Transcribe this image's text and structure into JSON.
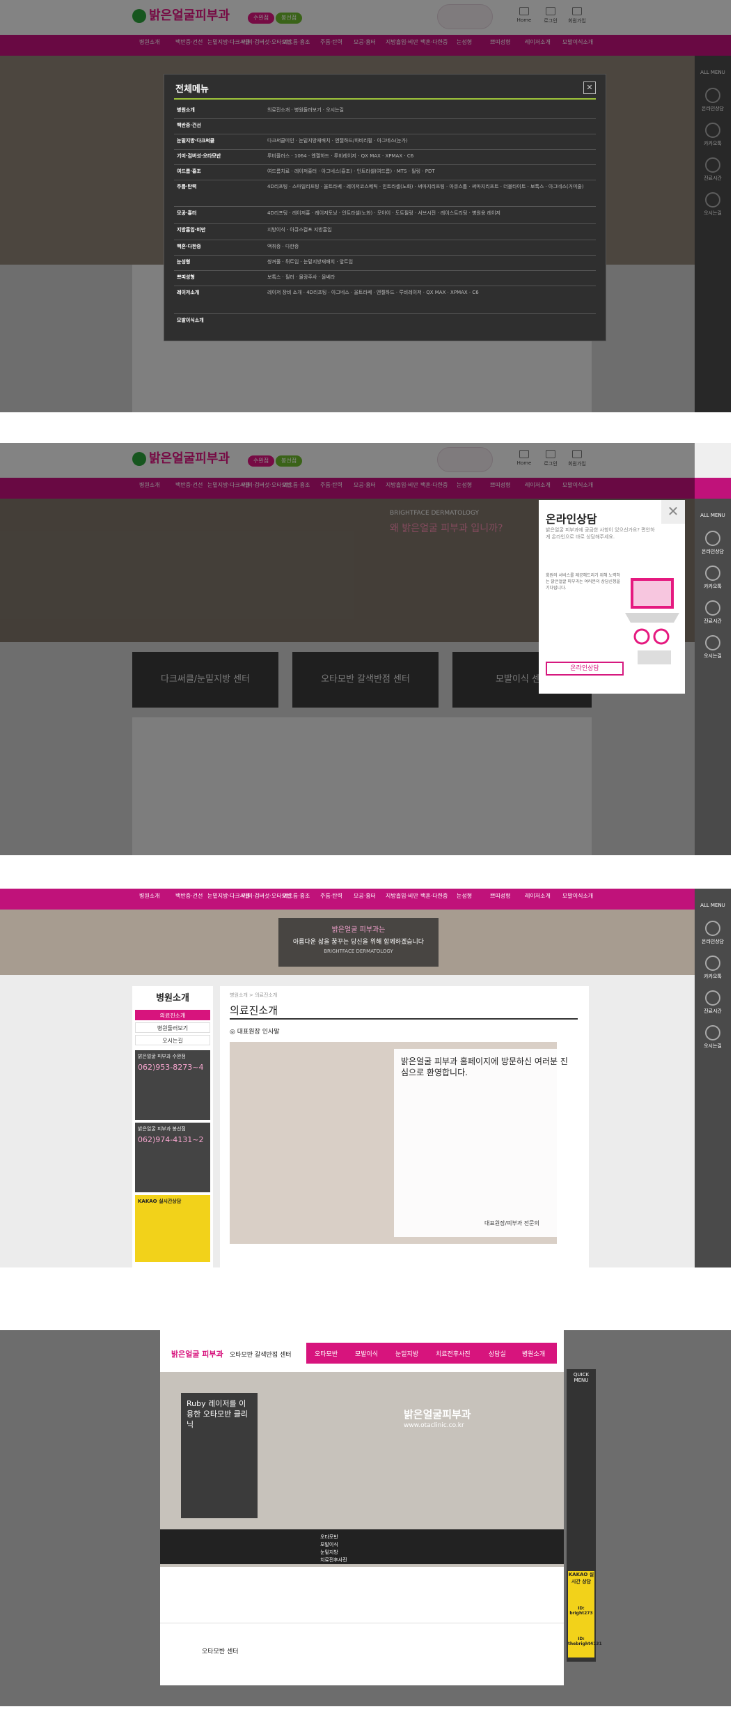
{
  "logo": {
    "name": "밝은얼굴피부과"
  },
  "branches": {
    "suwan": "수완점",
    "bongseon": "봉선점"
  },
  "utility": {
    "home": "Home",
    "login": "로그인",
    "join": "회원가입"
  },
  "nav": [
    "병원소개",
    "백반증·건선",
    "눈밑지방·다크써클",
    "기미·검버섯·오타모반",
    "여드름·흉조",
    "주름·탄력",
    "모공·흉터",
    "지방흡입·비만",
    "백혼·다한증",
    "눈성형",
    "쁘띠성형",
    "레이저소개",
    "모발이식소개"
  ],
  "side_menu": {
    "all": "ALL MENU",
    "items": [
      "온라인상담",
      "카카오톡",
      "진료시간",
      "오시는길"
    ]
  },
  "full_menu": {
    "title": "전체메뉴",
    "rows": [
      {
        "cat": "병원소개",
        "subs": "의료진소개 · 병원둘러보기 · 오시는길"
      },
      {
        "cat": "백반증·건선",
        "subs": ""
      },
      {
        "cat": "눈밑지방·다크써클",
        "subs": "다크써클미인 · 눈밑지방재배치 · 엔젤하드/하비리필 · 아그네스(눈가)"
      },
      {
        "cat": "기미·검버섯·오타모반",
        "subs": "루비플러스 · 1064 · 엔젤하드 · 루비레이저 · QX MAX · XPMAX · C6"
      },
      {
        "cat": "여드름·흉조",
        "subs": "여드름치료 · 레이저흉터 · 아그네스(흉조) · 인트라셀(여드름) · MTS · 필링 · PDT"
      },
      {
        "cat": "주름·탄력",
        "subs": "4D리프팅 · 스마일리프팅 · 울트라쎄 · 레이저코스메틱 · 인트라셀(노화) · 써마지리프팅 · 아큐스톰 · 써마지리프트 · 더블타이트 · 보톡스 · 아그네스(거미줄)"
      },
      {
        "cat": "모공·흉터",
        "subs": "4D리프팅 · 레이저흉 · 레이저토닝 · 인트라셀(노화) · 모아이 · 도트필링 · 서브시전 · 레이스트리팅 · 병원용 레이저"
      },
      {
        "cat": "지방흡입·비만",
        "subs": "지방이식 · 아큐스컬프 지방흡입"
      },
      {
        "cat": "백혼·다한증",
        "subs": "액취증 · 다한증"
      },
      {
        "cat": "눈성형",
        "subs": "쌍꺼풀 · 뒤트임 · 눈밑지방재배치 · 앞트임"
      },
      {
        "cat": "쁘띠성형",
        "subs": "보톡스 · 필러 · 물광주사 · 울쎄라"
      },
      {
        "cat": "레이저소개",
        "subs": "레이저 장비 소개 · 4D리프팅 · 아그네스 · 울트라쎄 · 엔젤하드 · 루비레이저 · QX MAX · XPMAX · C6"
      },
      {
        "cat": "모발이식소개",
        "subs": ""
      }
    ]
  },
  "consult": {
    "title": "온라인상담",
    "subtitle": "밝은얼굴 피부과에 궁금한 사항이 있으신가요? 편안하게 온라인으로 바로 상담해주세요.",
    "body": "회원의 서비스를 제공해드리기 위해 노력하는 밝은얼굴 피부과는 여러분의 상담신청을 기다립니다.",
    "button": "온라인상담"
  },
  "cards": [
    "다크써클/눈밑지방 센터",
    "오타모반 갈색반점 센터",
    "모발이식 센터"
  ],
  "p2_banner": {
    "brand": "BRIGHTFACE DERMATOLOGY",
    "title": "왜 밝은얼굴 피부과 입니까?"
  },
  "p3": {
    "banner_title": "밝은얼굴 피부과는",
    "banner_sub": "아름다운 삶을 꿈꾸는 당신을 위해 함께하겠습니다",
    "banner_brand": "BRIGHTFACE DERMATOLOGY",
    "lnb_title": "병원소개",
    "lnb_items": [
      "의료진소개",
      "병원둘러보기",
      "오시는길"
    ],
    "breadcrumb": "병원소개 > 의료진소개",
    "page_title": "의료진소개",
    "section": "대표원장 인사말",
    "greeting": "밝은얼굴 피부과 홈페이지에 방문하신 여러분 진심으로 환영합니다.",
    "sign": "대표원장/피부과 전문의",
    "suwan_title": "밝은얼굴 피부과 수완점",
    "suwan_tel": "062)953-8273~4",
    "bong_title": "밝은얼굴 피부과 봉선점",
    "bong_tel": "062)974-4131~2",
    "kakao": "KAKAO 실시간상담"
  },
  "p4": {
    "logo": "밝은얼굴 피부과",
    "center": "오타모반 갈색반점 센터",
    "nav": [
      "오타모반",
      "모발이식",
      "눈밑지방",
      "치료전후사진",
      "상담실",
      "병원소개"
    ],
    "visual_title": "Ruby 레이저를 이용한 오타모반 클리닉",
    "brand": "밝은얼굴피부과",
    "url": "www.otaclinic.co.kr",
    "list": [
      "오타모반",
      "모발이식",
      "눈밑지방",
      "치료전후사진"
    ],
    "quick": "QUICK MENU",
    "footer": "오타모반 센터",
    "kakao": "KAKAO 실시간 상담",
    "id1": "ID: bright273",
    "id2": "ID: thebright4131"
  },
  "colors": {
    "brand": "#c0127a",
    "accent": "#9ec53a",
    "dark": "#2f2f2f"
  }
}
